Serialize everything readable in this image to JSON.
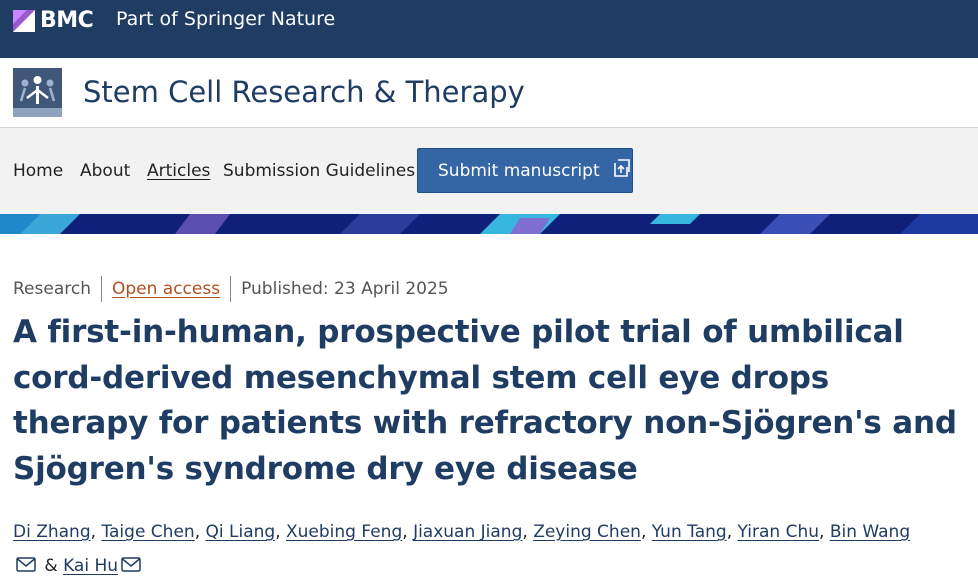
{
  "brand": {
    "logo_text": "BMC",
    "tagline": "Part of Springer Nature"
  },
  "journal": {
    "title": "Stem Cell Research & Therapy"
  },
  "nav": {
    "items": [
      {
        "label": "Home"
      },
      {
        "label": "About"
      },
      {
        "label": "Articles"
      },
      {
        "label": "Submission Guidelines"
      }
    ],
    "submit_label": "Submit manuscript"
  },
  "article": {
    "type": "Research",
    "access": "Open access",
    "published": "Published: 23 April 2025",
    "title": "A first-in-human, prospective pilot trial of umbilical cord-derived mesenchymal stem cell eye drops therapy for patients with refractory non-Sjögren's and Sjögren's syndrome dry eye disease",
    "authors": [
      "Di Zhang",
      "Taige Chen",
      "Qi Liang",
      "Xuebing Feng",
      "Jiaxuan Jiang",
      "Zeying Chen",
      "Yun Tang",
      "Yiran Chu",
      "Bin Wang",
      "Kai Hu"
    ],
    "author_separator": ", ",
    "final_conjunction": "&"
  },
  "colors": {
    "topbar": "#1f3c62",
    "primary_text": "#1f3c62",
    "button": "#3465a4",
    "open_access": "#b0501d",
    "banner": "#0f1f7a"
  }
}
